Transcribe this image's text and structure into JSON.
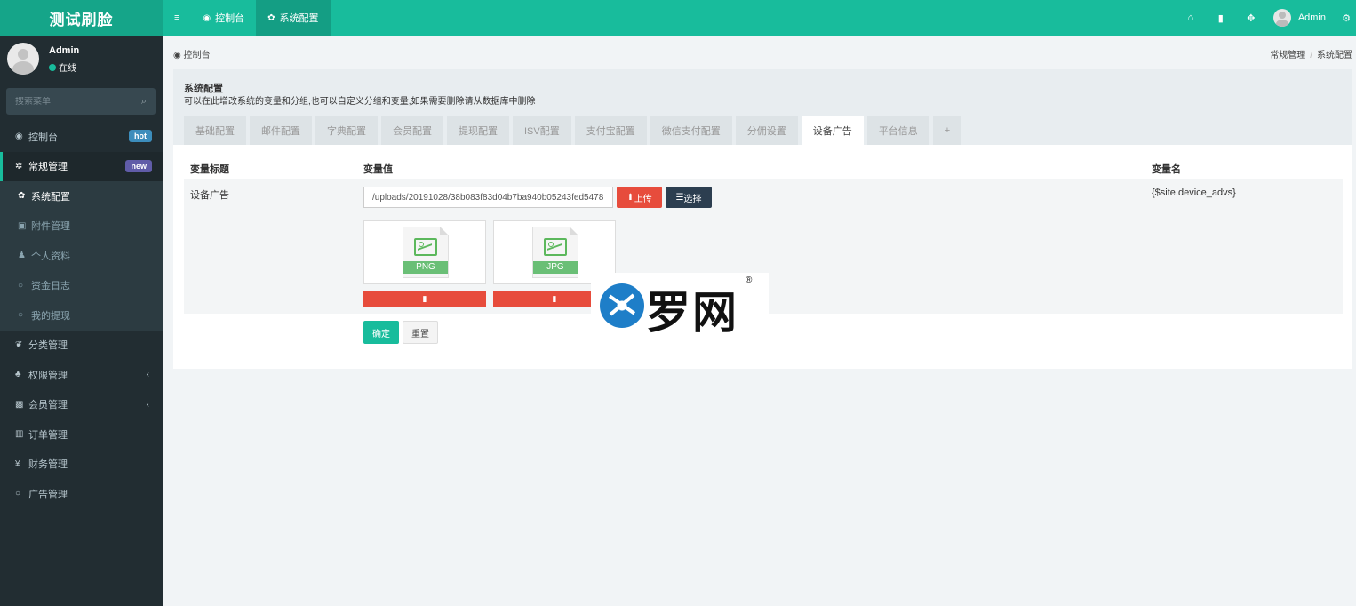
{
  "brand": "测试刷脸",
  "topnav": {
    "menu_icon": "≡",
    "items": [
      {
        "icon": "dashboard-icon",
        "label": "控制台"
      },
      {
        "icon": "gear-icon",
        "label": "系统配置"
      }
    ],
    "right_icons": [
      "home-icon",
      "trash-icon",
      "fullscreen-icon"
    ],
    "user_name": "Admin",
    "settings_icon": "gears-icon"
  },
  "sidebar": {
    "user": {
      "name": "Admin",
      "status": "在线"
    },
    "search_placeholder": "搜索菜单",
    "items": [
      {
        "label": "控制台",
        "badge": "hot"
      },
      {
        "label": "常规管理",
        "badge": "new"
      },
      {
        "label": "系统配置"
      },
      {
        "label": "附件管理"
      },
      {
        "label": "个人资料"
      },
      {
        "label": "资金日志"
      },
      {
        "label": "我的提现"
      },
      {
        "label": "分类管理"
      },
      {
        "label": "权限管理"
      },
      {
        "label": "会员管理"
      },
      {
        "label": "订单管理"
      },
      {
        "label": "财务管理"
      },
      {
        "label": "广告管理"
      }
    ]
  },
  "breadcrumb": {
    "left": "控制台",
    "right": [
      "常规管理",
      "系统配置"
    ]
  },
  "panel": {
    "title": "系统配置",
    "desc": "可以在此增改系统的变量和分组,也可以自定义分组和变量,如果需要删除请从数据库中删除",
    "tabs": [
      "基础配置",
      "邮件配置",
      "字典配置",
      "会员配置",
      "提现配置",
      "ISV配置",
      "支付宝配置",
      "微信支付配置",
      "分佣设置",
      "设备广告",
      "平台信息",
      "+"
    ],
    "active_tab": "设备广告"
  },
  "table": {
    "headers": [
      "变量标题",
      "变量值",
      "变量名"
    ],
    "row": {
      "title": "设备广告",
      "value": "/uploads/20191028/38b083f83d04b7ba940b05243fed5478",
      "var_name": "{$site.device_advs}"
    },
    "upload_label": "上传",
    "choose_label": "选择",
    "files": [
      {
        "type": "PNG"
      },
      {
        "type": "JPG"
      }
    ]
  },
  "actions": {
    "ok": "确定",
    "reset": "重置"
  },
  "watermark": {
    "text": "罗网",
    "reg": "®"
  },
  "colors": {
    "accent": "#18bc9c",
    "sidebar": "#222d32",
    "danger": "#e74c3c",
    "dark": "#2c3e50"
  }
}
